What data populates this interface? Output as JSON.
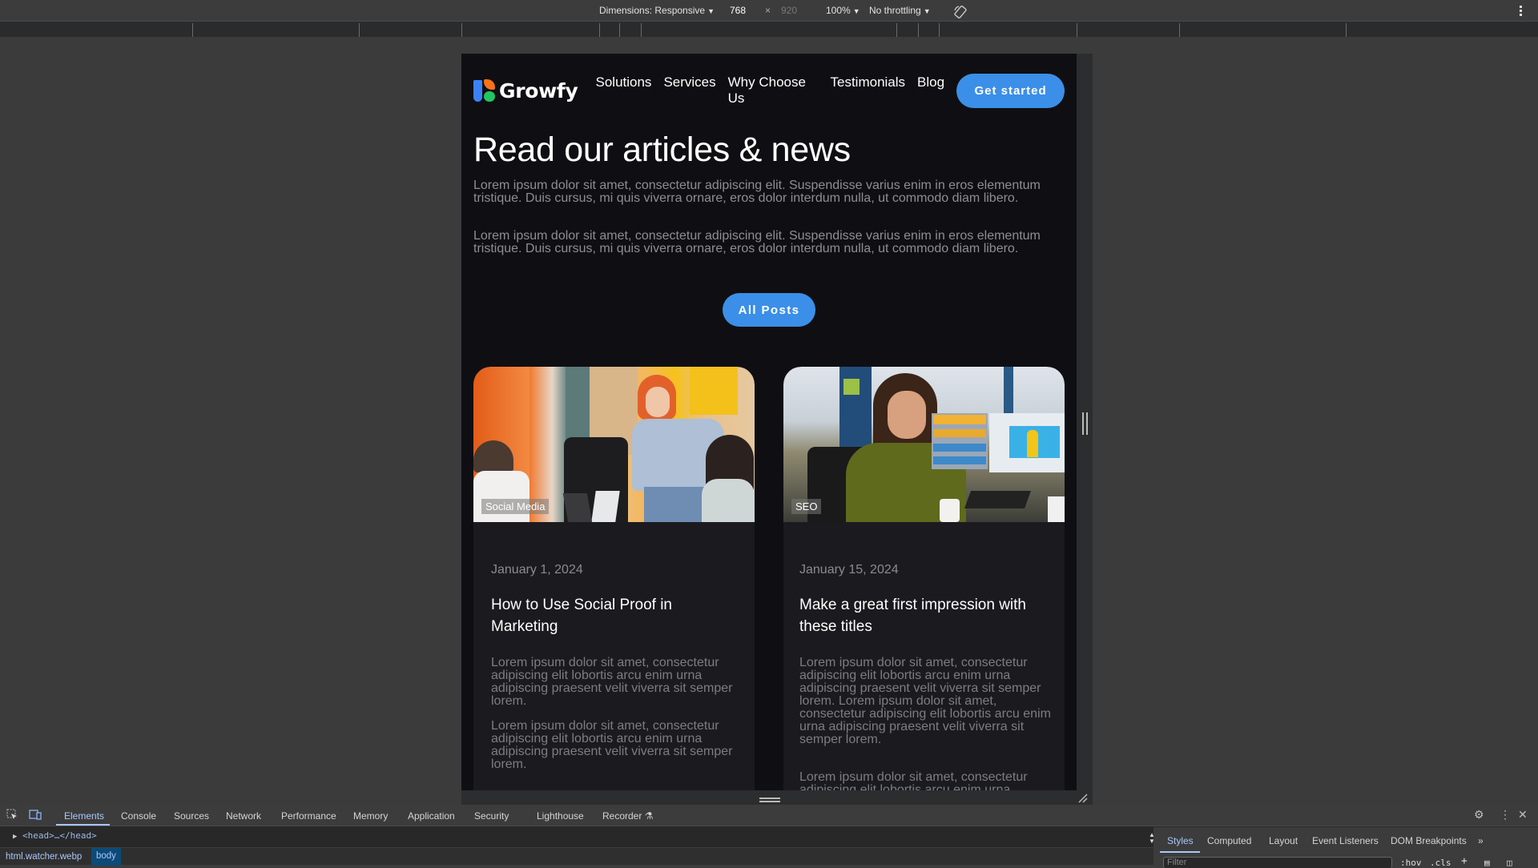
{
  "device_toolbar": {
    "dimensions_label": "Dimensions: Responsive",
    "width": "768",
    "times": "×",
    "height": "920",
    "zoom": "100%",
    "throttling": "No throttling"
  },
  "page": {
    "brand": "Growfy",
    "nav": [
      "Solutions",
      "Services",
      "Why Choose Us",
      "Testimonials",
      "Blog"
    ],
    "cta_label": "Get started",
    "title": "Read our articles & news",
    "paragraphs": [
      "Lorem ipsum dolor sit amet, consectetur adipiscing elit. Suspendisse varius enim in eros elementum tristique. Duis cursus, mi quis viverra ornare, eros dolor interdum nulla, ut commodo diam libero.",
      "Lorem ipsum dolor sit amet, consectetur adipiscing elit. Suspendisse varius enim in eros elementum tristique. Duis cursus, mi quis viverra ornare, eros dolor interdum nulla, ut commodo diam libero."
    ],
    "all_posts_label": "All Posts",
    "posts": [
      {
        "tag": "Social Media",
        "date": "January 1, 2024",
        "title": "How to Use Social Proof in Marketing",
        "body": [
          "Lorem ipsum dolor sit amet, consectetur adipiscing elit lobortis arcu enim urna adipiscing praesent velit viverra sit semper lorem.",
          "Lorem ipsum dolor sit amet, consectetur adipiscing elit lobortis arcu enim urna adipiscing praesent velit viverra sit semper lorem."
        ]
      },
      {
        "tag": "SEO",
        "date": "January 15, 2024",
        "title": "Make a great first impression with these titles",
        "body": [
          "Lorem ipsum dolor sit amet, consectetur adipiscing elit lobortis arcu enim urna adipiscing praesent velit viverra sit semper lorem. Lorem ipsum dolor sit amet, consectetur adipiscing elit lobortis arcu enim urna adipiscing praesent velit viverra sit semper lorem.",
          "Lorem ipsum dolor sit amet, consectetur adipiscing elit lobortis arcu enim urna adipiscing praesent velit viverra sit"
        ]
      }
    ],
    "colors": {
      "accent": "#3b8fe8",
      "background": "#0f0f13",
      "card": "#1b1b1f"
    }
  },
  "devtools": {
    "tabs": [
      "Elements",
      "Console",
      "Sources",
      "Network",
      "Performance",
      "Memory",
      "Application",
      "Security",
      "Lighthouse",
      "Recorder"
    ],
    "active_tab": "Elements",
    "dom_node": "<head>…</head>",
    "breadcrumbs": [
      "html.watcher.webp",
      "body"
    ],
    "side_tabs": [
      "Styles",
      "Computed",
      "Layout",
      "Event Listeners",
      "DOM Breakpoints"
    ],
    "side_more": "»",
    "filter_placeholder": "Filter",
    "hov": ":hov",
    "cls": ".cls"
  }
}
